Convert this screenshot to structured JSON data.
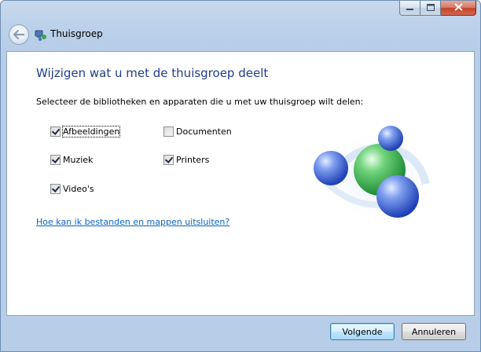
{
  "window": {
    "title": "Thuisgroep",
    "caption_buttons": {
      "minimize_icon": "minimize-icon",
      "maximize_icon": "maximize-icon",
      "close_icon": "close-icon"
    }
  },
  "content": {
    "heading": "Wijzigen wat u met de thuisgroep deelt",
    "instruction": "Selecteer de bibliotheken en apparaten die u met uw thuisgroep wilt delen:",
    "libraries": [
      {
        "label": "Afbeeldingen",
        "checked": true
      },
      {
        "label": "Muziek",
        "checked": true
      },
      {
        "label": "Video's",
        "checked": true
      },
      {
        "label": "Documenten",
        "checked": false
      },
      {
        "label": "Printers",
        "checked": true
      }
    ],
    "exclude_link": "Hoe kan ik bestanden en mappen uitsluiten?"
  },
  "footer": {
    "next_label": "Volgende",
    "cancel_label": "Annuleren"
  },
  "colors": {
    "heading": "#1e3e8a",
    "link": "#0b64c3",
    "frame": "#b8cde7"
  }
}
